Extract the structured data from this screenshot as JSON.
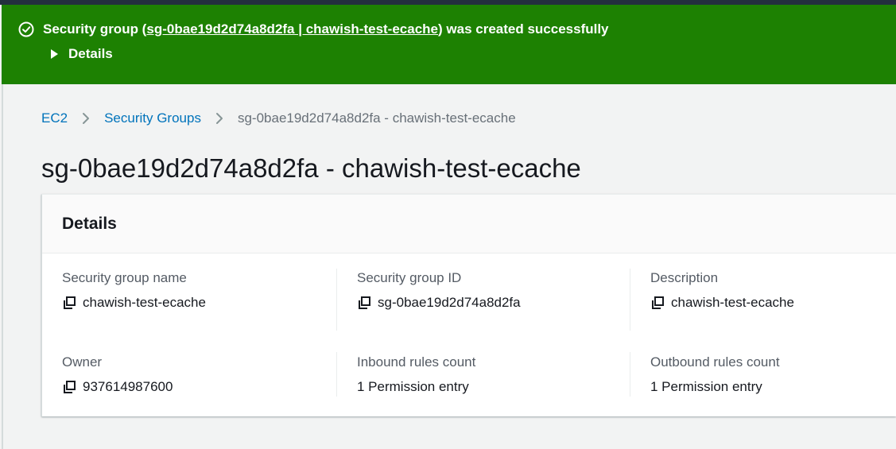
{
  "flash": {
    "prefix": "Security group (",
    "link": "sg-0bae19d2d74a8d2fa | chawish-test-ecache",
    "suffix": ") was created successfully",
    "details_label": "Details",
    "color": "#1d8102",
    "icon": "check-circle-icon"
  },
  "breadcrumb": {
    "items": [
      "EC2",
      "Security Groups",
      "sg-0bae19d2d74a8d2fa - chawish-test-ecache"
    ]
  },
  "page": {
    "title": "sg-0bae19d2d74a8d2fa - chawish-test-ecache"
  },
  "details": {
    "heading": "Details",
    "fields": [
      {
        "label": "Security group name",
        "value": "chawish-test-ecache",
        "copyable": true
      },
      {
        "label": "Security group ID",
        "value": "sg-0bae19d2d74a8d2fa",
        "copyable": true
      },
      {
        "label": "Description",
        "value": "chawish-test-ecache",
        "copyable": true
      },
      {
        "label": "Owner",
        "value": "937614987600",
        "copyable": true
      },
      {
        "label": "Inbound rules count",
        "value": "1 Permission entry",
        "copyable": false
      },
      {
        "label": "Outbound rules count",
        "value": "1 Permission entry",
        "copyable": false
      }
    ]
  },
  "colors": {
    "link": "#0073bb",
    "success": "#1d8102",
    "header_bar": "#232f3e"
  }
}
